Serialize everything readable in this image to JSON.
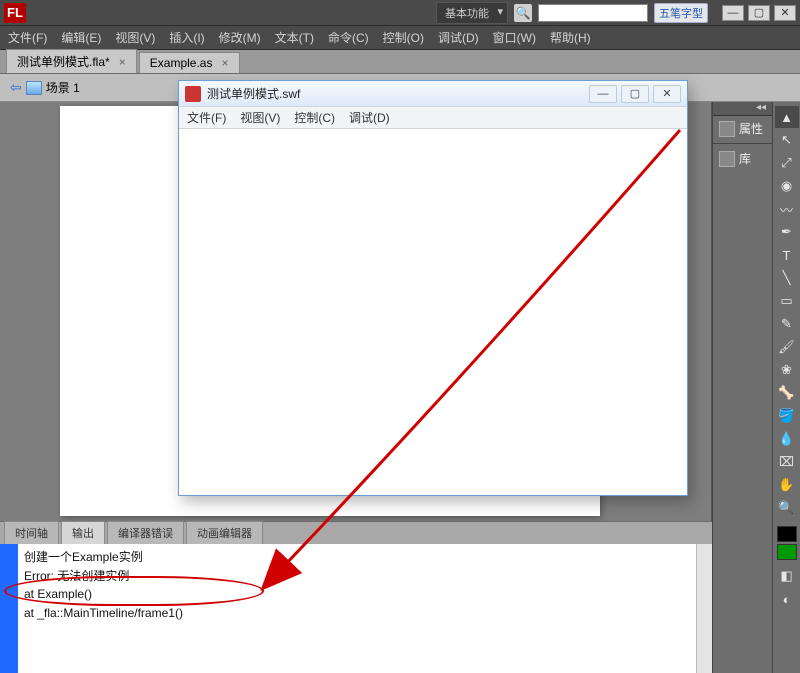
{
  "app": {
    "logo": "FL",
    "workspace": "基本功能",
    "ime_hint": "五笔字型"
  },
  "menu": {
    "file": "文件(F)",
    "edit": "编辑(E)",
    "view": "视图(V)",
    "insert": "插入(I)",
    "modify": "修改(M)",
    "text": "文本(T)",
    "commands": "命令(C)",
    "control": "控制(O)",
    "debug": "调试(D)",
    "window": "窗口(W)",
    "help": "帮助(H)"
  },
  "tabs": {
    "doc1": "测试单例模式.fla*",
    "doc2": "Example.as"
  },
  "scene": {
    "name": "场景 1"
  },
  "right_dock": {
    "properties": "属性",
    "library": "库"
  },
  "panel_tabs": {
    "timeline": "时间轴",
    "output": "输出",
    "compiler": "编译器错误",
    "motion": "动画编辑器"
  },
  "output": {
    "line1": "创建一个Example实例",
    "line2": "Error: 无法创建实例",
    "line3": "    at Example()",
    "line4": "    at _fla::MainTimeline/frame1()"
  },
  "swf": {
    "title": "测试单例模式.swf",
    "menu": {
      "file": "文件(F)",
      "view": "视图(V)",
      "control": "控制(C)",
      "debug": "调试(D)"
    }
  },
  "icons": {
    "selection": "▲",
    "subsel": "↖",
    "freetrans": "⤢",
    "threed": "◉",
    "lasso": "〰",
    "pen": "✒",
    "text": "T",
    "line": "╲",
    "rect": "▭",
    "pencil": "✎",
    "brush": "🖌",
    "deco": "❀",
    "bone": "🦴",
    "bucket": "🪣",
    "dropper": "💧",
    "eraser": "⌧",
    "hand": "✋",
    "zoom": "🔍",
    "options1": "◧",
    "options2": "◐"
  }
}
